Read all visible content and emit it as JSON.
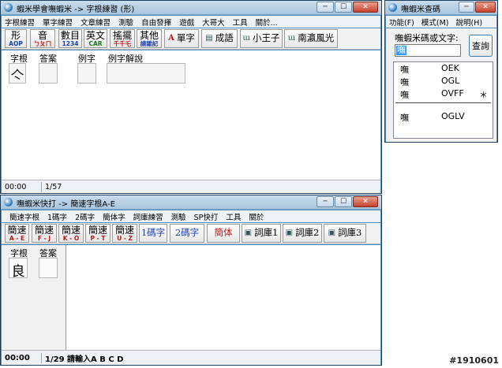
{
  "win1": {
    "title": "蝦米學會嘸蝦米 -> 字根練習 (形)",
    "menu": [
      "字根練習",
      "單字練習",
      "文章練習",
      "測驗",
      "自由發揮",
      "遊戲",
      "大哥大",
      "工具",
      "關於..."
    ],
    "tools": [
      {
        "big": "形",
        "small": "AOP",
        "color": "#1a3fb0"
      },
      {
        "big": "音",
        "small": "ㄅㄆㄇ",
        "color": "#c01818"
      },
      {
        "big": "數目",
        "small": "1234",
        "color": "#1a3fb0"
      },
      {
        "big": "英文",
        "small": "CAR",
        "color": "#1a7a1a"
      },
      {
        "big": "搖擺",
        "small": "千千乇",
        "color": "#c01818"
      },
      {
        "big": "其他",
        "small": "請雜記",
        "color": "#1a3fb0"
      }
    ],
    "wide_tools": [
      "單字",
      "成語",
      "小王子",
      "南瀛風光"
    ],
    "labels": {
      "root": "字根",
      "answer": "答案",
      "example": "例字",
      "explain": "例字解說"
    },
    "root_char": "亽",
    "status": {
      "time": "00:00",
      "progress": "1/57"
    }
  },
  "win2": {
    "title": "嘸蝦米查碼",
    "menu": [
      "功能(F)",
      "模式(M)",
      "說明(H)"
    ],
    "prompt": "嘸蝦米碼或文字:",
    "input_value": "嘸",
    "query_button": "查詢",
    "results": [
      {
        "char": "嘸",
        "code": "OEK",
        "mark": ""
      },
      {
        "char": "嘸",
        "code": "OGL",
        "mark": ""
      },
      {
        "char": "嘸",
        "code": "OVFF",
        "mark": "＊"
      },
      {
        "char": "嘸",
        "code": "OGLV",
        "mark": ""
      }
    ]
  },
  "win3": {
    "title": "嘸蝦米快打 -> 簡速字根A-E",
    "menu": [
      "簡速字根",
      "1碼字",
      "2碼字",
      "簡体字",
      "詞庫練習",
      "測驗",
      "SP快打",
      "工具",
      "關於"
    ],
    "tools": [
      {
        "big": "簡速",
        "small": "A - E"
      },
      {
        "big": "簡速",
        "small": "F - J"
      },
      {
        "big": "簡速",
        "small": "K - O"
      },
      {
        "big": "簡速",
        "small": "P - T"
      },
      {
        "big": "簡速",
        "small": "U - Z"
      }
    ],
    "wide_tools": [
      {
        "label": "1碼字",
        "icon": ""
      },
      {
        "label": "2碼字",
        "icon": ""
      },
      {
        "label": "簡体",
        "icon": ""
      },
      {
        "label": "詞庫1",
        "icon": "▣"
      },
      {
        "label": "詞庫2",
        "icon": "▣"
      },
      {
        "label": "詞庫3",
        "icon": "▣"
      }
    ],
    "labels": {
      "root": "字根",
      "answer": "答案"
    },
    "root_char": "良",
    "status": {
      "time": "00:00",
      "progress": "1/29 請輸入A B C D"
    }
  },
  "watermark": "#1910601",
  "colors": {
    "frame": "#4d8fbf",
    "title_gradient_top": "#c9dcec",
    "close": "#c6422d",
    "selection": "#3399ff"
  }
}
